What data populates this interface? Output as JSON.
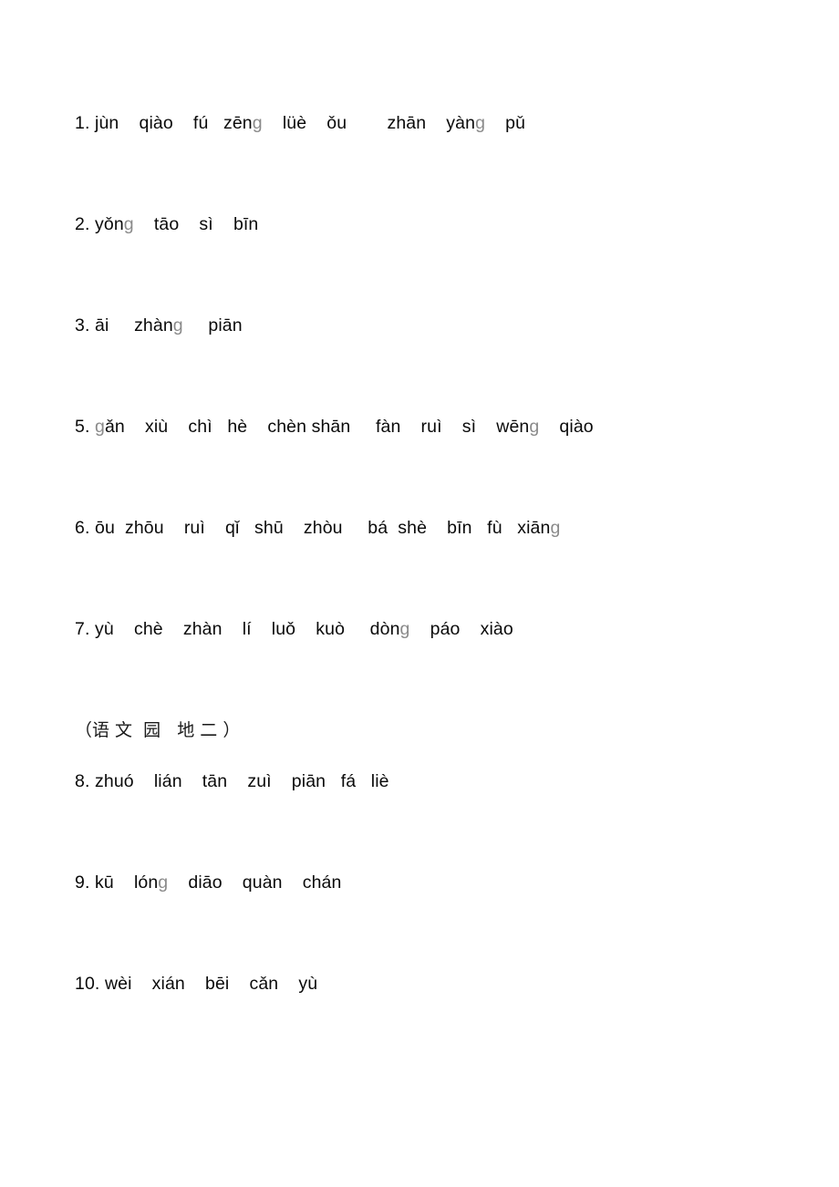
{
  "document": {
    "type": "pinyin-worksheet",
    "background_color": "#ffffff",
    "text_color": "#0a0a0a",
    "faint_glyph_color": "#8a8a8a",
    "lines": [
      {
        "id": "line-1",
        "number": "1.",
        "text": "1. jùn    qiào    fú   zēng    lüè    ǒu        zhān    yàng    pǔ",
        "syllables": [
          "jùn",
          "qiào",
          "fú",
          "zēng",
          "lüè",
          "ǒu",
          "zhān",
          "yàng",
          "pǔ"
        ]
      },
      {
        "id": "line-2",
        "number": "2.",
        "text": "2. yǒng    tāo    sì    bīn",
        "syllables": [
          "yǒng",
          "tāo",
          "sì",
          "bīn"
        ]
      },
      {
        "id": "line-3",
        "number": "3.",
        "text": "3. āi     zhàng     piān",
        "syllables": [
          "āi",
          "zhàng",
          "piān"
        ]
      },
      {
        "id": "line-5",
        "number": "5.",
        "text": "5. gǎn    xiù    chì   hè    chèn shān     fàn    ruì    sì    wēng    qiào",
        "syllables": [
          "gǎn",
          "xiù",
          "chì",
          "hè",
          "chèn",
          "shān",
          "fàn",
          "ruì",
          "sì",
          "wēng",
          "qiào"
        ]
      },
      {
        "id": "line-6",
        "number": "6.",
        "text": "6. ōu  zhōu    ruì    qǐ   shū    zhòu     bá  shè    bīn   fù   xiāng",
        "syllables": [
          "ōu",
          "zhōu",
          "ruì",
          "qǐ",
          "shū",
          "zhòu",
          "bá",
          "shè",
          "bīn",
          "fù",
          "xiāng"
        ]
      },
      {
        "id": "line-7",
        "number": "7.",
        "text": "7. yù    chè    zhàn    lí    luǒ    kuò     dòng    páo    xiào",
        "syllables": [
          "yù",
          "chè",
          "zhàn",
          "lí",
          "luǒ",
          "kuò",
          "dòng",
          "páo",
          "xiào"
        ]
      },
      {
        "id": "line-8",
        "number": "8.",
        "text": "8. zhuó    lián    tān    zuì    piān   fá   liè",
        "syllables": [
          "zhuó",
          "lián",
          "tān",
          "zuì",
          "piān",
          "fá",
          "liè"
        ]
      },
      {
        "id": "line-9",
        "number": "9.",
        "text": "9. kū    lóng    diāo    quàn    chán",
        "syllables": [
          "kū",
          "lóng",
          "diāo",
          "quàn",
          "chán"
        ]
      },
      {
        "id": "line-10",
        "number": "10.",
        "text": "10. wèi    xián    bēi    cǎn    yù",
        "syllables": [
          "wèi",
          "xián",
          "bēi",
          "cǎn",
          "yù"
        ]
      }
    ],
    "section_heading": {
      "id": "section-heading-yuwen-yuandi-er",
      "text": "（语 文  园   地 二 ）",
      "plain": "（语文园地二）",
      "meaning_label": "Chinese Language Garden Two"
    }
  }
}
